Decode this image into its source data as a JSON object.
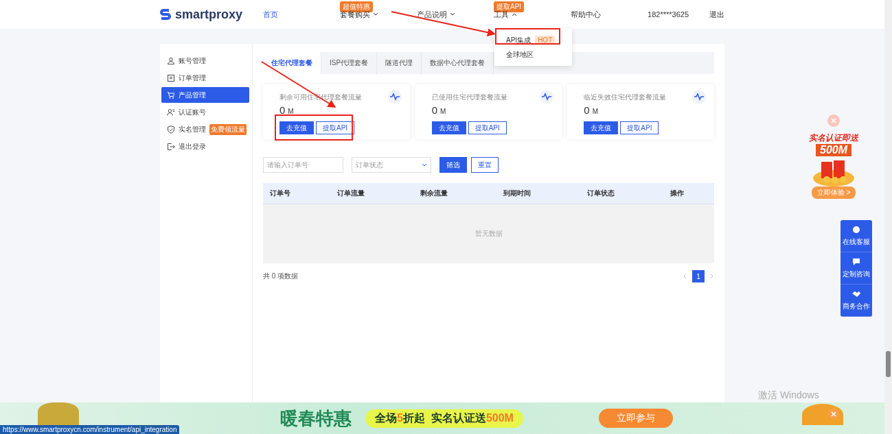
{
  "header": {
    "logo": "smartproxy",
    "nav": [
      {
        "label": "首页",
        "selected": true
      },
      {
        "label": "套餐购买",
        "selected": false,
        "badge": "超值特惠",
        "expanded": false
      },
      {
        "label": "产品说明",
        "selected": false,
        "expanded": false
      },
      {
        "label": "工具",
        "selected": false,
        "badge": "提取API",
        "expanded": true
      },
      {
        "label": "帮助中心",
        "selected": false
      }
    ],
    "phone": "182****3625",
    "logout": "退出",
    "dropdown": [
      {
        "label": "API集成",
        "tag": "HOT"
      },
      {
        "label": "全球地区"
      }
    ]
  },
  "sidebar": {
    "items": [
      {
        "label": "账号管理",
        "selected": false
      },
      {
        "label": "订单管理",
        "selected": false
      },
      {
        "label": "产品管理",
        "selected": true
      },
      {
        "label": "认证账号",
        "selected": false
      },
      {
        "label": "实名管理",
        "selected": false,
        "badge": "免费领流量"
      },
      {
        "label": "退出登录",
        "selected": false
      }
    ]
  },
  "tabs": [
    {
      "label": "住宅代理套餐",
      "selected": true
    },
    {
      "label": "ISP代理套餐",
      "selected": false
    },
    {
      "label": "隧道代理",
      "selected": false
    },
    {
      "label": "数据中心代理套餐",
      "selected": false
    }
  ],
  "stat_cards": [
    {
      "title": "剩余可用住宅代理套餐流量",
      "value": "0",
      "unit": "M",
      "buttons": [
        "去充值",
        "提取API"
      ]
    },
    {
      "title": "已使用住宅代理套餐流量",
      "value": "0",
      "unit": "M",
      "buttons": [
        "去充值",
        "提取API"
      ]
    },
    {
      "title": "临近失效住宅代理套餐流量",
      "value": "0",
      "unit": "M",
      "buttons": [
        "去充值",
        "提取API"
      ]
    }
  ],
  "filter": {
    "order_field": {
      "placeholder": "请输入订单号"
    },
    "status_select": {
      "placeholder": "订单状态"
    },
    "buttons": [
      "筛选",
      "重置"
    ]
  },
  "table": {
    "columns": [
      "订单号",
      "订单流量",
      "剩余流量",
      "到期时间",
      "订单状态",
      "操作"
    ],
    "empty_text": "暂无数据"
  },
  "footer": {
    "total": "共 0 项数据",
    "pages": [
      {
        "label": "1",
        "selected": true
      }
    ]
  },
  "promo": {
    "headline": "实名认证即送",
    "amount": "500M",
    "button": "立即体验 >"
  },
  "float_panel": [
    "在线客服",
    "定制咨询",
    "商务合作"
  ],
  "banner": {
    "title": "暖春特惠",
    "slogan": [
      {
        "text": "全场",
        "highlight": false
      },
      {
        "text": "5",
        "highlight": true
      },
      {
        "text": "折起",
        "highlight": false
      },
      {
        "text": "实名认证送",
        "highlight": false
      },
      {
        "text": "500M",
        "highlight": true
      }
    ],
    "button": "立即参与"
  },
  "status_url": "https://www.smartproxycn.com/instrument/api_integration",
  "os_notice": "激活 Windows"
}
